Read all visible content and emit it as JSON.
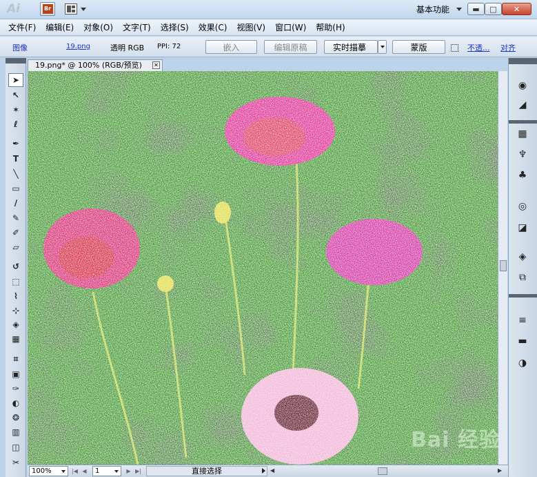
{
  "app": {
    "logo_text": "Ai",
    "bridge_label": "Br",
    "workspace": "基本功能",
    "window_buttons": {
      "minimize": "▬",
      "maximize": "□",
      "close": "✕"
    }
  },
  "menu": {
    "items": [
      "文件(F)",
      "编辑(E)",
      "对象(O)",
      "文字(T)",
      "选择(S)",
      "效果(C)",
      "视图(V)",
      "窗口(W)",
      "帮助(H)"
    ]
  },
  "control_bar": {
    "image_label": "图像",
    "file_name": "19.png",
    "color_info": "透明 RGB",
    "ppi": "PPI: 72",
    "embed": "嵌入",
    "edit_original": "编辑原稿",
    "live_trace": "实时描摹",
    "mask": "蒙版",
    "opacity": "不透...",
    "align": "对齐"
  },
  "document": {
    "tab_title": "19.png* @ 100% (RGB/预览)",
    "tab_close": "✕"
  },
  "tools": [
    "selection-tool",
    "direct-selection-tool",
    "magic-wand-tool",
    "lasso-tool",
    "pen-tool",
    "type-tool",
    "line-tool",
    "rectangle-tool",
    "paintbrush-tool",
    "pencil-tool",
    "blob-brush-tool",
    "eraser-tool",
    "rotate-tool",
    "scale-tool",
    "warp-tool",
    "free-transform-tool",
    "shape-builder-tool",
    "perspective-grid-tool",
    "mesh-tool",
    "gradient-tool",
    "eyedropper-tool",
    "blend-tool",
    "symbol-sprayer-tool",
    "column-graph-tool",
    "artboard-tool",
    "slice-tool"
  ],
  "tool_glyphs": [
    "➤",
    "↖",
    "✶",
    "ℓ",
    "✒",
    "T",
    "╲",
    "▭",
    "∕",
    "✎",
    "✐",
    "▱",
    "↺",
    "⬚",
    "⌇",
    "⊹",
    "◈",
    "▦",
    "⌗",
    "▣",
    "✑",
    "◐",
    "❂",
    "▥",
    "◫",
    "✂"
  ],
  "status_bar": {
    "zoom": "100%",
    "page": "1",
    "status": "直接选择"
  },
  "right_panel_icons": [
    "color-icon",
    "color-guide-icon",
    "swatches-icon",
    "brushes-icon",
    "symbols-icon",
    "appearance-icon",
    "graphic-styles-icon",
    "layers-icon",
    "artboards-icon",
    "stroke-icon",
    "gradient-icon",
    "transparency-icon"
  ],
  "right_panel_glyphs": [
    "◉",
    "◢",
    "▦",
    "♆",
    "♣",
    "◎",
    "◪",
    "◈",
    "⧉",
    "≡",
    "▬",
    "◑"
  ],
  "watermark": "Bai 经验",
  "colors": {
    "accent_link": "#1a34c8",
    "canvas_bg": "#2e3a2c"
  }
}
